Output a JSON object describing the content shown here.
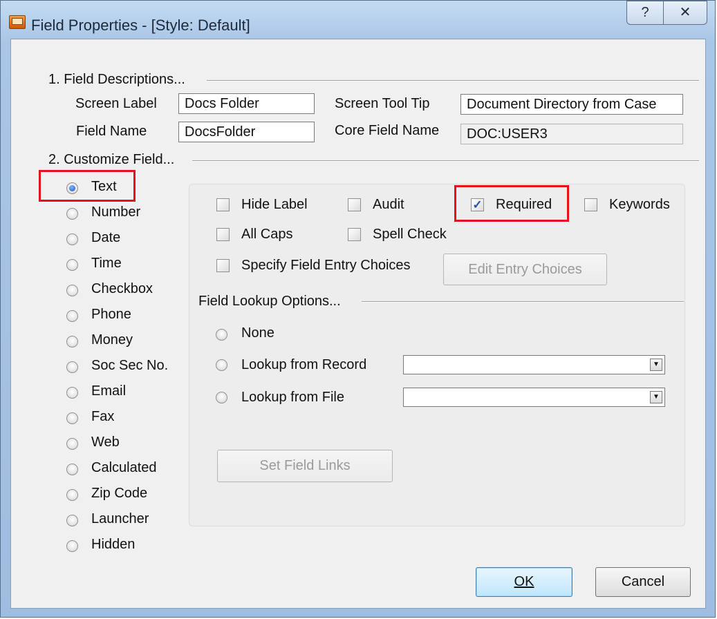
{
  "window": {
    "title": "Field Properties - [Style: Default]",
    "help_glyph": "?",
    "close_glyph": "✕"
  },
  "sections": {
    "descriptions": "1. Field Descriptions...",
    "customize": "2. Customize Field...",
    "lookup": "Field Lookup Options..."
  },
  "fields": {
    "screen_label": {
      "label": "Screen Label",
      "value": "Docs Folder"
    },
    "field_name": {
      "label": "Field Name",
      "value": "DocsFolder"
    },
    "tool_tip": {
      "label": "Screen Tool Tip",
      "value": "Document Directory from Case"
    },
    "core_field": {
      "label": "Core Field Name",
      "value": "DOC:USER3"
    }
  },
  "types": [
    "Text",
    "Number",
    "Date",
    "Time",
    "Checkbox",
    "Phone",
    "Money",
    "Soc Sec No.",
    "Email",
    "Fax",
    "Web",
    "Calculated",
    "Zip Code",
    "Launcher",
    "Hidden"
  ],
  "selected_type": "Text",
  "options": {
    "hide_label": {
      "label": "Hide Label",
      "checked": false
    },
    "audit": {
      "label": "Audit",
      "checked": false
    },
    "required": {
      "label": "Required",
      "checked": true
    },
    "keywords": {
      "label": "Keywords",
      "checked": false
    },
    "all_caps": {
      "label": "All Caps",
      "checked": false
    },
    "spell_check": {
      "label": "Spell Check",
      "checked": false
    },
    "specify_choices": {
      "label": "Specify Field Entry Choices",
      "checked": false
    }
  },
  "buttons": {
    "edit_choices": "Edit Entry Choices",
    "set_links": "Set Field Links",
    "ok": "OK",
    "cancel": "Cancel"
  },
  "lookup": {
    "none": "None",
    "from_record": "Lookup from Record",
    "from_file": "Lookup from File",
    "record_value": "",
    "file_value": ""
  },
  "icons": {
    "check": "✓",
    "dropdown": "▼"
  },
  "colors": {
    "highlight": "#e8111a",
    "accent": "#2154a5"
  }
}
